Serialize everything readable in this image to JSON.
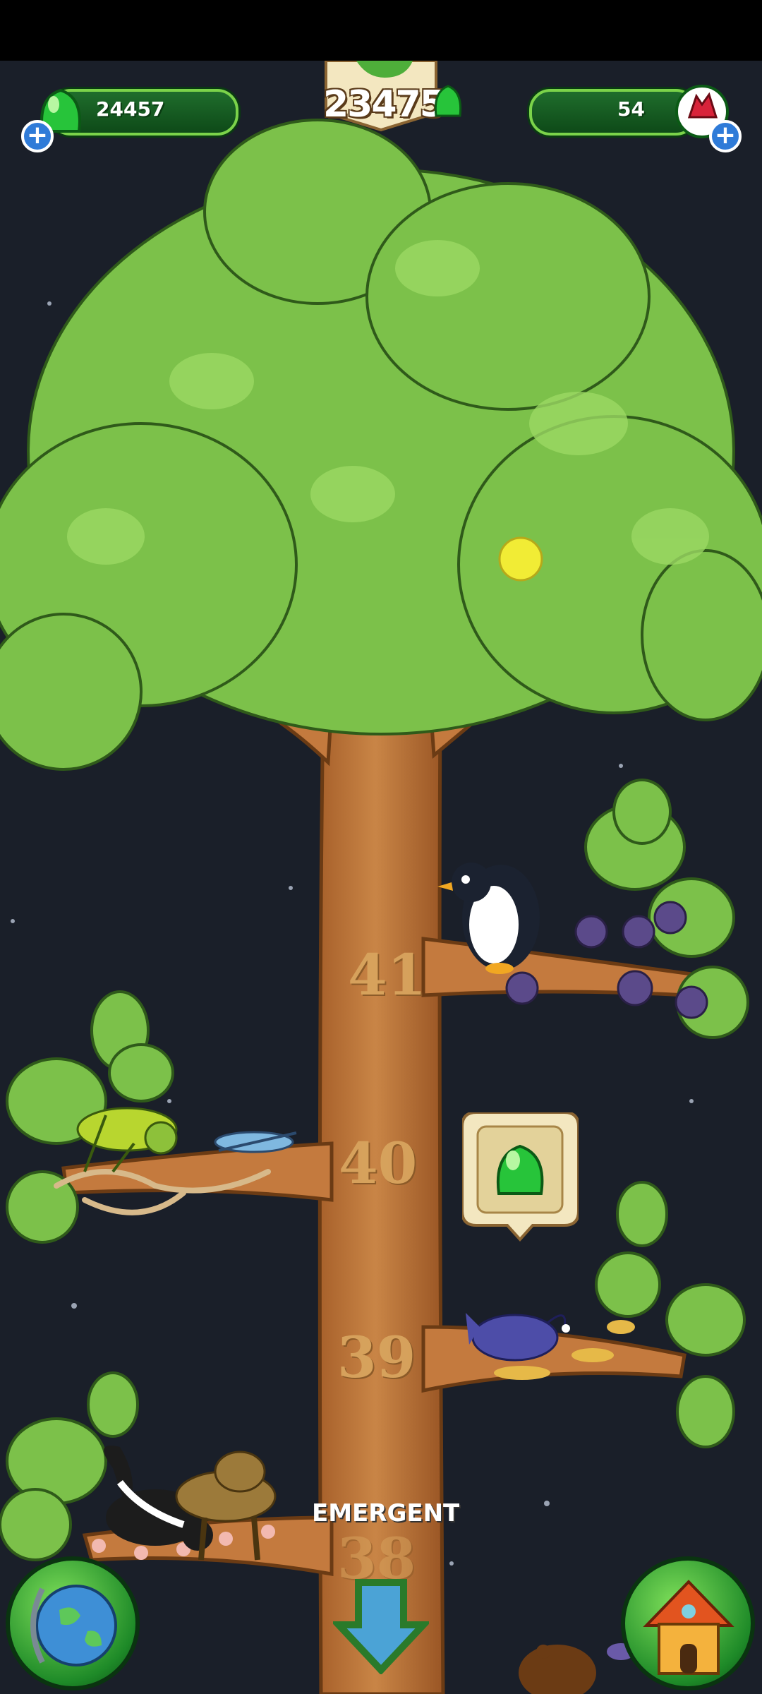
{
  "hud": {
    "gems": "24457",
    "score": "23475",
    "rubies": "54"
  },
  "levels": [
    "41",
    "40",
    "39",
    "38"
  ],
  "tier_label": "EMERGENT",
  "buttons": {
    "globe": "globe-icon",
    "home": "house-icon",
    "scroll_down": "down-arrow-icon"
  },
  "colors": {
    "background": "#1a1f29",
    "trunk": "#c47a3e",
    "leaf": "#7cc14a",
    "gem_green": "#27c43a"
  }
}
